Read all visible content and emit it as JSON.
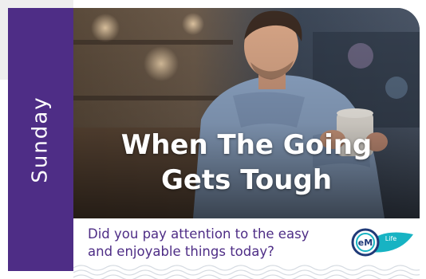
{
  "day_label": "Sunday",
  "headline": {
    "line1": "When The Going",
    "line2": "Gets Tough"
  },
  "caption": {
    "line1": "Did you pay attention to the easy",
    "line2": "and enjoyable things today?"
  },
  "logo": {
    "mark": "eM",
    "word": "Life",
    "icon": "em-life-logo"
  },
  "colors": {
    "brand_purple": "#4e2d86",
    "logo_teal": "#17b3c3",
    "logo_navy": "#1f3a78"
  }
}
